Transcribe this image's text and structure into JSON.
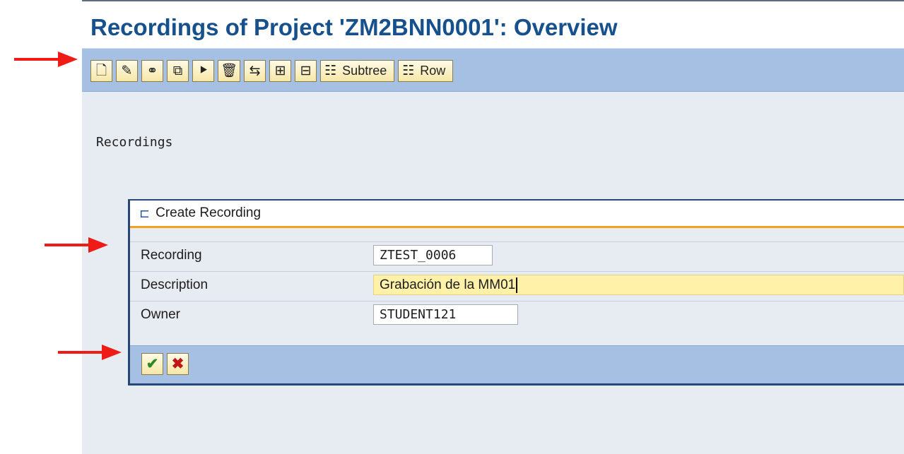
{
  "title": "Recordings of Project 'ZM2BNN0001': Overview",
  "toolbar": {
    "icons": [
      {
        "name": "new-document-icon",
        "glyph": "🗋"
      },
      {
        "name": "pencil-icon",
        "glyph": "✎"
      },
      {
        "name": "glasses-icon",
        "glyph": "⚭"
      },
      {
        "name": "copy-icon",
        "glyph": "⧉"
      },
      {
        "name": "process-icon",
        "glyph": "⯈"
      },
      {
        "name": "trash-icon",
        "glyph": "🗑"
      },
      {
        "name": "import-icon",
        "glyph": "⇆"
      },
      {
        "name": "expand-subtree-icon",
        "glyph": "⊞"
      },
      {
        "name": "collapse-subtree-icon",
        "glyph": "⊟"
      }
    ],
    "subtree_label": "Subtree",
    "row_label": "Row",
    "text_button_icon_glyph": "☷"
  },
  "section_label": "Recordings",
  "dialog": {
    "icon_glyph": "⊏",
    "title": "Create Recording",
    "fields": {
      "recording": {
        "label": "Recording",
        "value": "ZTEST_0006"
      },
      "description": {
        "label": "Description",
        "value": "Grabación de la MM01"
      },
      "owner": {
        "label": "Owner",
        "value": "STUDENT121"
      }
    },
    "ok_glyph": "✔",
    "cancel_glyph": "✖"
  },
  "colors": {
    "title": "#16508d",
    "toolbar": "#a5c0e2",
    "background": "#e7ebf2",
    "active_field": "#fff1a8",
    "dialog_border": "#27477a",
    "header_accent": "#f2a11a",
    "annotation_arrow": "#ee1b16"
  }
}
